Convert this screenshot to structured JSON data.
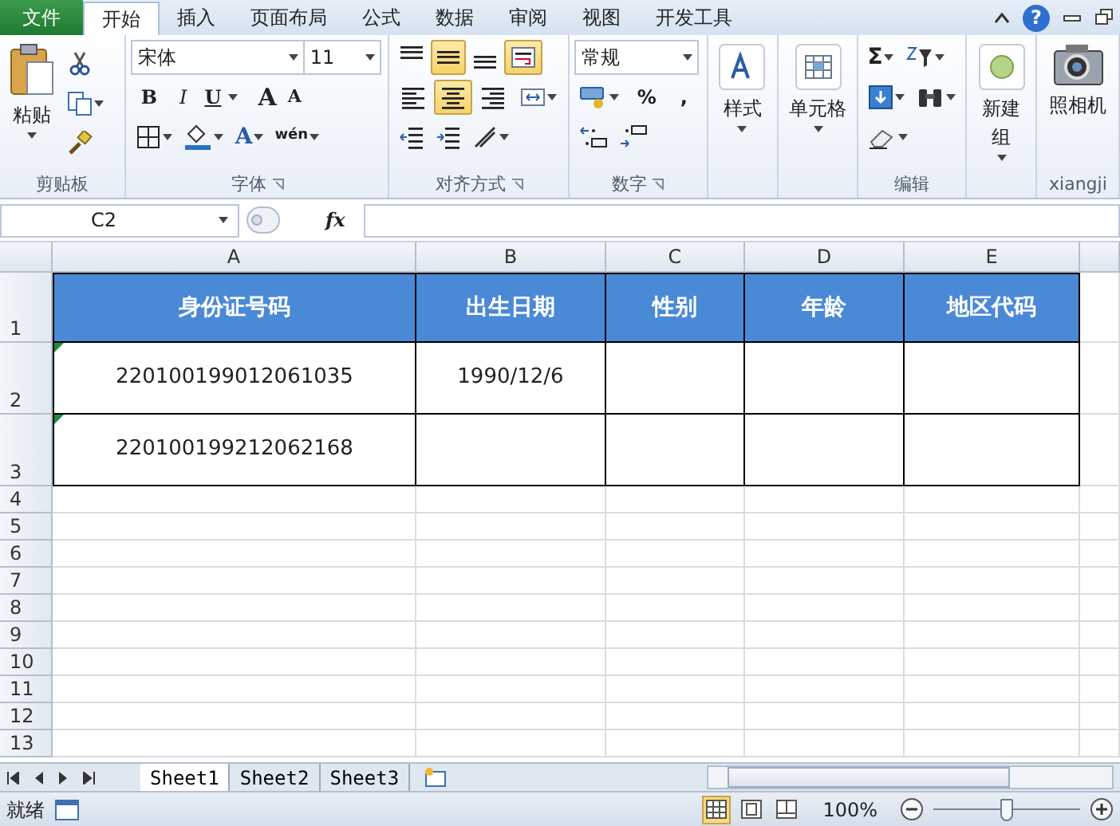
{
  "menu_tabs": [
    {
      "label": "文件",
      "kind": "file",
      "selected": false
    },
    {
      "label": "开始",
      "kind": "tab",
      "selected": true
    },
    {
      "label": "插入",
      "kind": "tab",
      "selected": false
    },
    {
      "label": "页面布局",
      "kind": "tab",
      "selected": false
    },
    {
      "label": "公式",
      "kind": "tab",
      "selected": false
    },
    {
      "label": "数据",
      "kind": "tab",
      "selected": false
    },
    {
      "label": "审阅",
      "kind": "tab",
      "selected": false
    },
    {
      "label": "视图",
      "kind": "tab",
      "selected": false
    },
    {
      "label": "开发工具",
      "kind": "tab",
      "selected": false
    }
  ],
  "help_glyph": "?",
  "ribbon": {
    "clipboard": {
      "label": "剪贴板",
      "paste": "粘贴"
    },
    "font": {
      "label": "字体",
      "font_name": "宋体",
      "font_size": "11",
      "bold": "B",
      "italic": "I",
      "underline": "U",
      "grow": "A",
      "shrink": "A",
      "font_color": "A",
      "phonetic": "wén"
    },
    "alignment": {
      "label": "对齐方式",
      "buttons": [
        {
          "kind": "align-top",
          "on": false
        },
        {
          "kind": "align-middle",
          "on": true
        },
        {
          "kind": "align-bottom",
          "on": false
        },
        {
          "kind": "wrap",
          "on": true
        },
        {
          "kind": "align-left",
          "on": false
        },
        {
          "kind": "align-center",
          "on": true
        },
        {
          "kind": "align-right",
          "on": false
        },
        {
          "kind": "merge",
          "on": false
        }
      ]
    },
    "number": {
      "label": "数字",
      "format": "常规",
      "percent": "%",
      "comma": ","
    },
    "styles": {
      "label": "样式"
    },
    "cells": {
      "label": "单元格"
    },
    "editing": {
      "label": "编辑",
      "sum": "Σ"
    },
    "new_group": {
      "label": "新建组"
    },
    "camera": {
      "label": "照相机",
      "group": "xiangji"
    }
  },
  "formula_bar": {
    "name_box": "C2",
    "fx": "fx"
  },
  "sheet": {
    "columns": [
      "A",
      "B",
      "C",
      "D",
      "E"
    ],
    "rows": [
      {
        "number": "1",
        "kind": "header",
        "cells": [
          "身份证号码",
          "出生日期",
          "性别",
          "年龄",
          "地区代码"
        ]
      },
      {
        "number": "2",
        "kind": "data",
        "error_mark": true,
        "cells": [
          "220100199012061035",
          "1990/12/6",
          "",
          "",
          ""
        ]
      },
      {
        "number": "3",
        "kind": "data",
        "error_mark": true,
        "cells": [
          "220100199212062168",
          "",
          "",
          "",
          ""
        ]
      },
      {
        "number": "4",
        "kind": "empty"
      },
      {
        "number": "5",
        "kind": "empty"
      },
      {
        "number": "6",
        "kind": "empty"
      },
      {
        "number": "7",
        "kind": "empty"
      },
      {
        "number": "8",
        "kind": "empty"
      },
      {
        "number": "9",
        "kind": "empty"
      },
      {
        "number": "10",
        "kind": "empty"
      },
      {
        "number": "11",
        "kind": "empty"
      },
      {
        "number": "12",
        "kind": "empty"
      },
      {
        "number": "13",
        "kind": "empty"
      }
    ]
  },
  "sheet_tabs": [
    {
      "label": "Sheet1",
      "selected": true
    },
    {
      "label": "Sheet2",
      "selected": false
    },
    {
      "label": "Sheet3",
      "selected": false
    }
  ],
  "status_bar": {
    "status": "就绪",
    "views": [
      {
        "kind": "normal",
        "selected": true
      },
      {
        "kind": "page-layout",
        "selected": false
      },
      {
        "kind": "page-break",
        "selected": false
      }
    ],
    "zoom": "100%",
    "zoom_slider": {
      "level": 0.5
    }
  }
}
